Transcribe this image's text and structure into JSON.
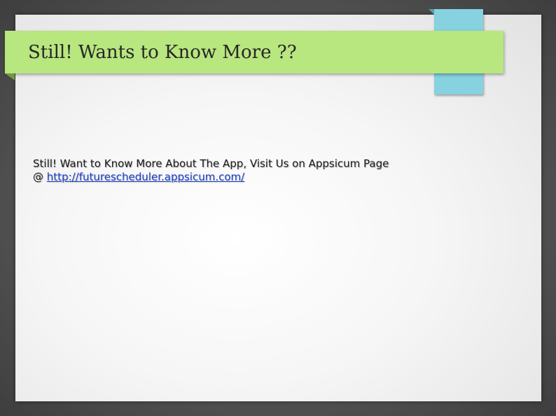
{
  "slide": {
    "title": "Still! Wants to Know More ??",
    "body_line1": "Still! Want to Know More About The App, Visit Us on Appsicum Page",
    "body_at": "@ ",
    "link_text": "http://futurescheduler.appsicum.com/"
  },
  "colors": {
    "title_bar": "#b8e67f",
    "accent_tab": "#86d2e0",
    "link": "#1a3fc9"
  }
}
